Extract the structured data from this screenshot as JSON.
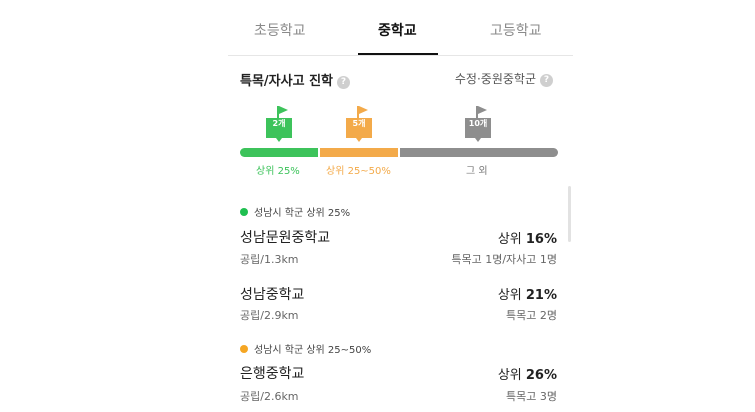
{
  "tabs": [
    {
      "label": "초등학교",
      "active": false
    },
    {
      "label": "중학교",
      "active": true
    },
    {
      "label": "고등학교",
      "active": false
    }
  ],
  "section": {
    "title": "특목/자사고 진학",
    "right_label": "수정·중원중학군",
    "help_glyph": "?"
  },
  "flags": [
    {
      "label": "2개",
      "color": "#3dc35b"
    },
    {
      "label": "5개",
      "color": "#f3aa4a"
    },
    {
      "label": "10개",
      "color": "#8e8e8e"
    }
  ],
  "bar_labels": {
    "top": "상위 25%",
    "mid": "상위 25~50%",
    "other": "그 외"
  },
  "groups": [
    {
      "label": "성남시 학군 상위 25%",
      "color": "#1fbf50",
      "schools": [
        {
          "name": "성남문원중학교",
          "sub": "공립/1.3km",
          "rank_prefix": "상위",
          "rank_value": "16%",
          "detail": "특목고 1명/자사고 1명"
        },
        {
          "name": "성남중학교",
          "sub": "공립/2.9km",
          "rank_prefix": "상위",
          "rank_value": "21%",
          "detail": "특목고 2명"
        }
      ]
    },
    {
      "label": "성남시 학군 상위 25~50%",
      "color": "#f5a623",
      "schools": [
        {
          "name": "은행중학교",
          "sub": "공립/2.6km",
          "rank_prefix": "상위",
          "rank_value": "26%",
          "detail": "특목고 3명"
        }
      ]
    }
  ]
}
